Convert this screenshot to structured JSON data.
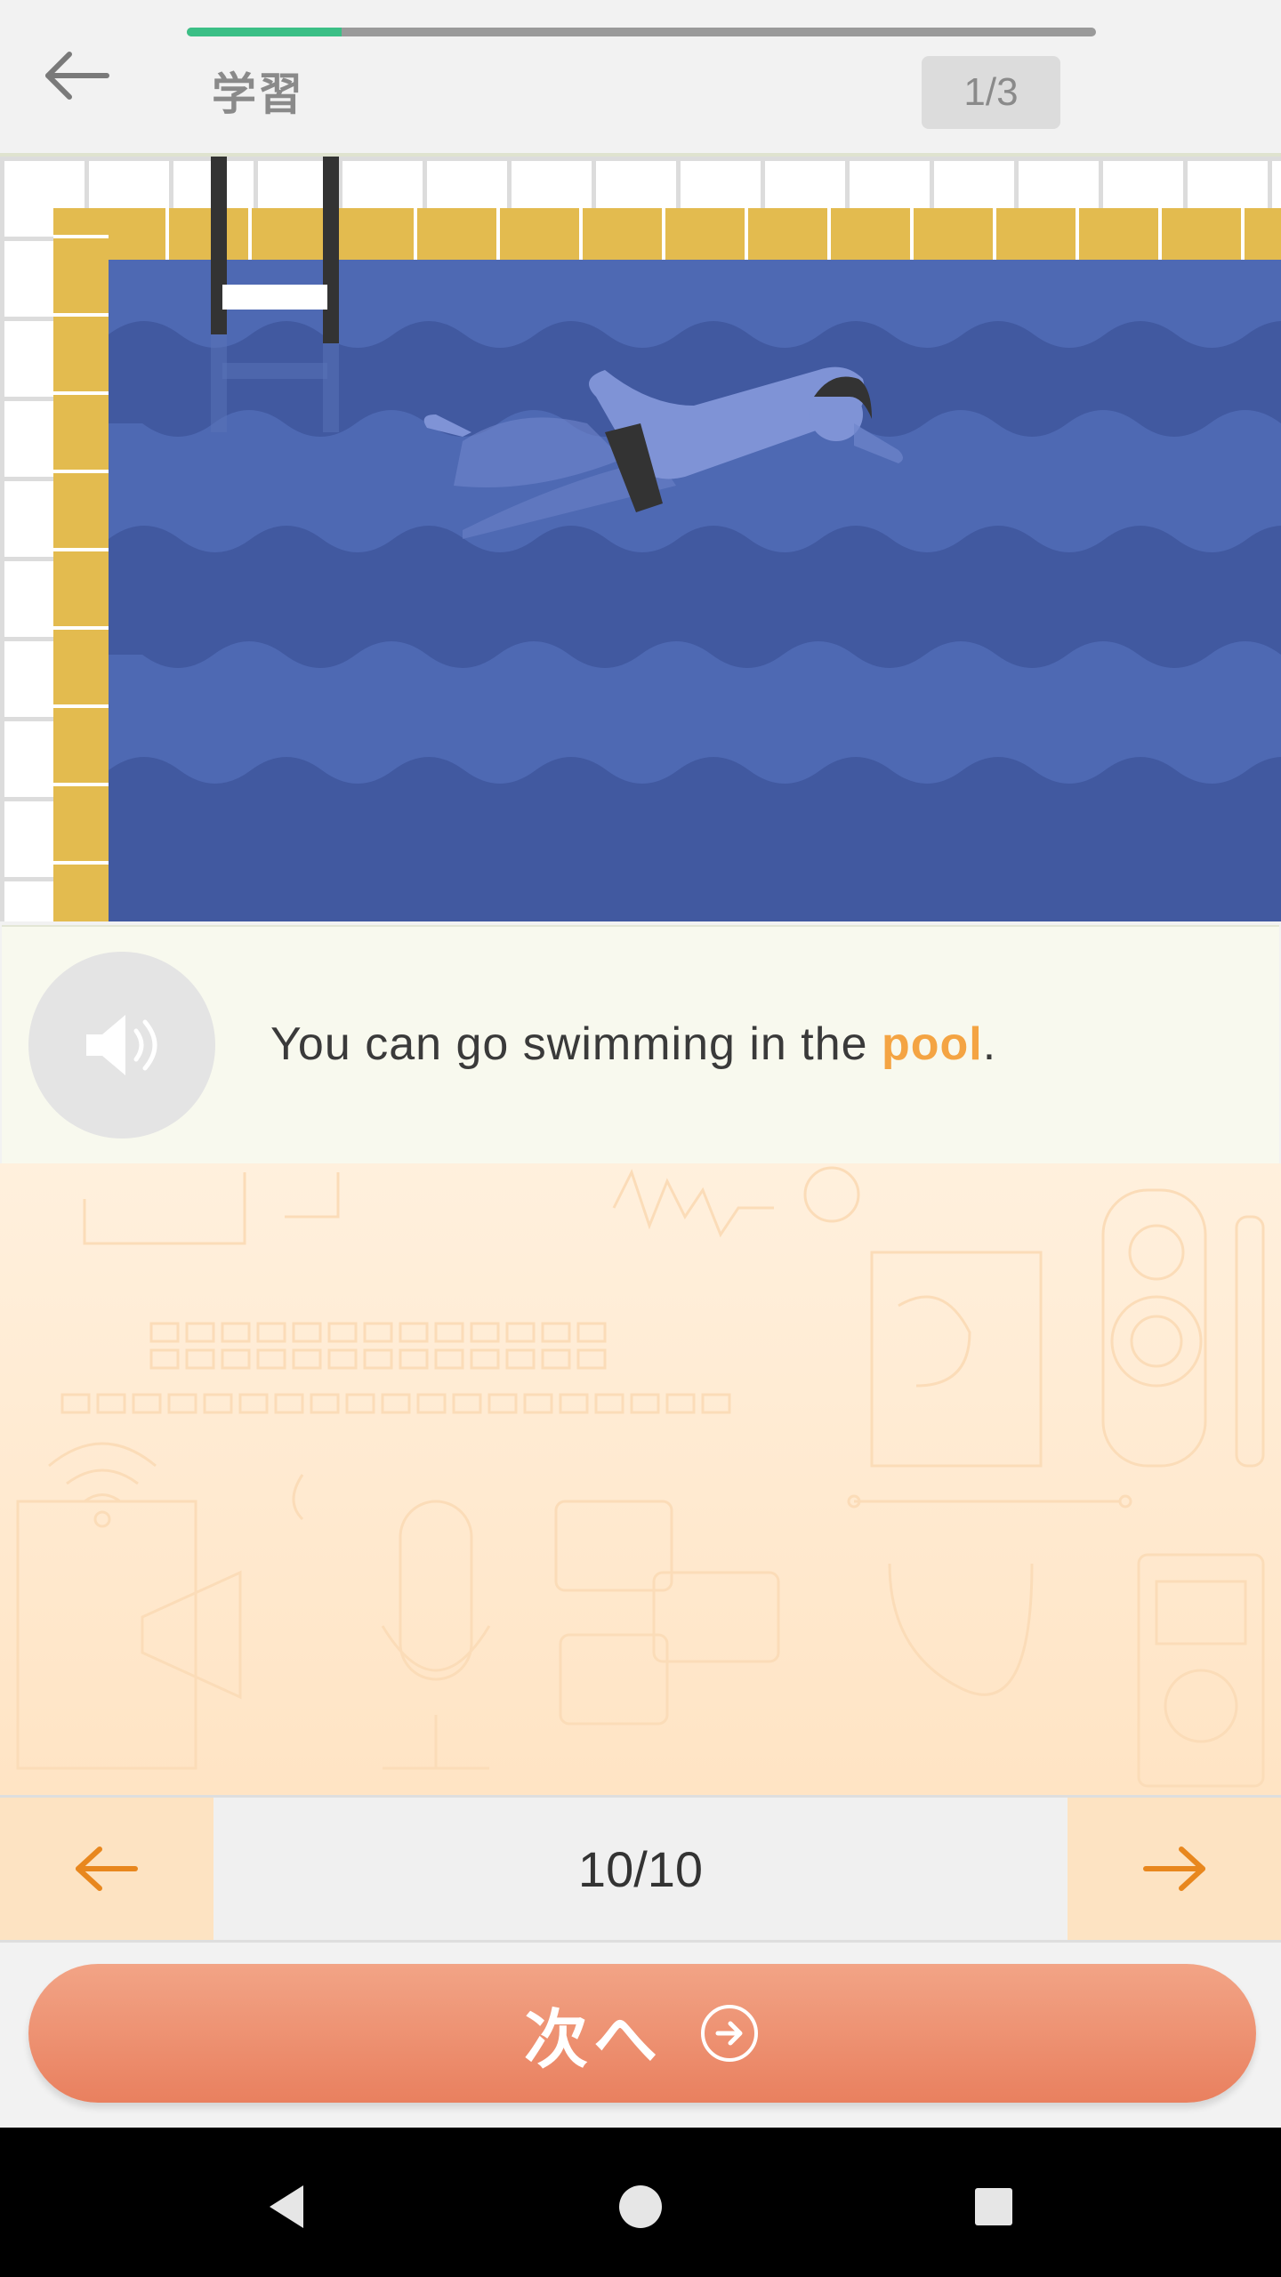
{
  "header": {
    "title": "学習",
    "step_counter": "1/3",
    "progress": 0.17
  },
  "sentence": {
    "before": "You can go swimming in the ",
    "highlight": "pool",
    "after": "."
  },
  "pager": {
    "count": "10/10"
  },
  "next_button": {
    "label": "次へ"
  },
  "icons": {
    "back": "arrow-left-icon",
    "speaker": "speaker-icon",
    "prev": "arrow-left-icon",
    "next": "arrow-right-icon",
    "next_circle": "circle-arrow-right-icon"
  },
  "colors": {
    "accent_orange": "#f4a443",
    "progress_green": "#3bbf86",
    "button_orange": "#e9805f",
    "pool_blue": "#4e69b3"
  }
}
